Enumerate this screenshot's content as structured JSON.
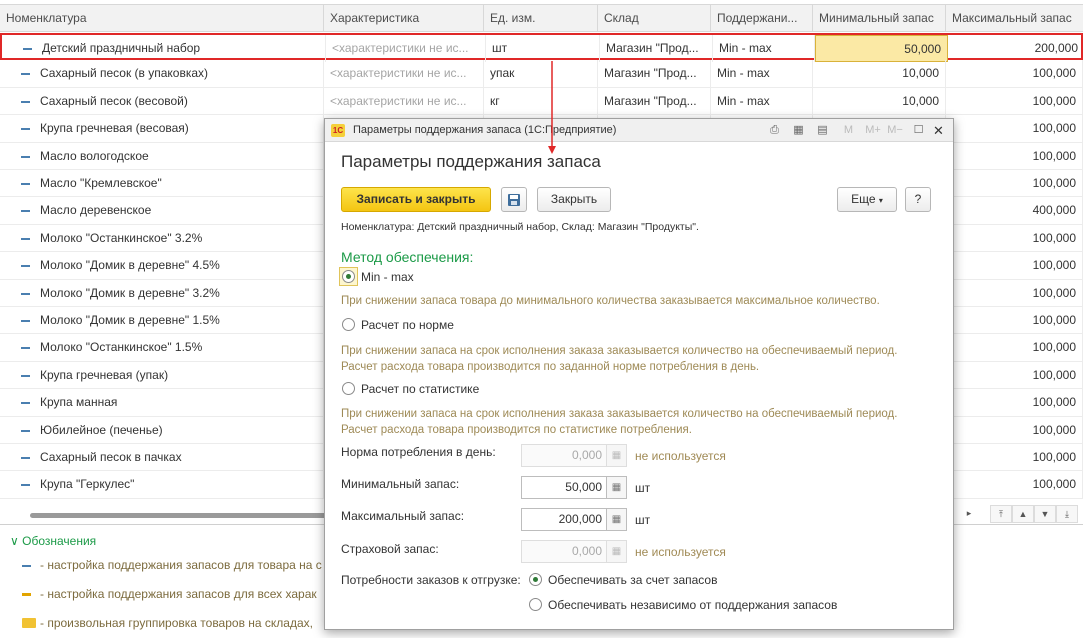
{
  "table": {
    "columns": [
      "Номенклатура",
      "Характеристика",
      "Ед. изм.",
      "Склад",
      "Поддержани...",
      "Минимальный запас",
      "Максимальный запас"
    ],
    "rows": [
      {
        "name": "Детский праздничный набор",
        "char": "<характеристики не ис...",
        "unit": "шт",
        "store": "Магазин \"Прод...",
        "method": "Min - max",
        "min": "50,000",
        "max": "200,000"
      },
      {
        "name": "Сахарный песок (в упаковках)",
        "char": "<характеристики не ис...",
        "unit": "упак",
        "store": "Магазин \"Прод...",
        "method": "Min - max",
        "min": "10,000",
        "max": "100,000"
      },
      {
        "name": "Сахарный песок (весовой)",
        "char": "<характеристики не ис...",
        "unit": "кг",
        "store": "Магазин \"Прод...",
        "method": "Min - max",
        "min": "10,000",
        "max": "100,000"
      },
      {
        "name": "Крупа гречневая (весовая)",
        "char": "",
        "unit": "",
        "store": "",
        "method": "",
        "min": "",
        "max": "100,000"
      },
      {
        "name": "Масло вологодское",
        "char": "",
        "unit": "",
        "store": "",
        "method": "",
        "min": "",
        "max": "100,000"
      },
      {
        "name": "Масло \"Кремлевское\"",
        "char": "",
        "unit": "",
        "store": "",
        "method": "",
        "min": "",
        "max": "100,000"
      },
      {
        "name": "Масло деревенское",
        "char": "",
        "unit": "",
        "store": "",
        "method": "",
        "min": "",
        "max": "400,000"
      },
      {
        "name": "Молоко \"Останкинское\" 3.2%",
        "char": "",
        "unit": "",
        "store": "",
        "method": "",
        "min": "",
        "max": "100,000"
      },
      {
        "name": "Молоко \"Домик в деревне\" 4.5%",
        "char": "",
        "unit": "",
        "store": "",
        "method": "",
        "min": "",
        "max": "100,000"
      },
      {
        "name": "Молоко \"Домик в деревне\" 3.2%",
        "char": "",
        "unit": "",
        "store": "",
        "method": "",
        "min": "",
        "max": "100,000"
      },
      {
        "name": "Молоко \"Домик в деревне\" 1.5%",
        "char": "",
        "unit": "",
        "store": "",
        "method": "",
        "min": "",
        "max": "100,000"
      },
      {
        "name": "Молоко \"Останкинское\" 1.5%",
        "char": "",
        "unit": "",
        "store": "",
        "method": "",
        "min": "",
        "max": "100,000"
      },
      {
        "name": "Крупа гречневая (упак)",
        "char": "",
        "unit": "",
        "store": "",
        "method": "",
        "min": "",
        "max": "100,000"
      },
      {
        "name": "Крупа манная",
        "char": "",
        "unit": "",
        "store": "",
        "method": "",
        "min": "",
        "max": "100,000"
      },
      {
        "name": "Юбилейное (печенье)",
        "char": "",
        "unit": "",
        "store": "",
        "method": "",
        "min": "",
        "max": "100,000"
      },
      {
        "name": "Сахарный песок в пачках",
        "char": "",
        "unit": "",
        "store": "",
        "method": "",
        "min": "",
        "max": "100,000"
      },
      {
        "name": "Крупа \"Геркулес\"",
        "char": "",
        "unit": "",
        "store": "",
        "method": "",
        "min": "",
        "max": "100,000"
      }
    ]
  },
  "legend": {
    "title": "Обозначения",
    "items": [
      "- настройка поддержания запасов для товара на с",
      "- настройка поддержания запасов для всех харак",
      "- произвольная группировка товаров на складах,"
    ]
  },
  "dialog": {
    "window_title": "Параметры поддержания запаса  (1С:Предприятие)",
    "logo": "1С",
    "title": "Параметры поддержания запаса",
    "btn_save_close": "Записать и закрыть",
    "btn_close": "Закрыть",
    "btn_more": "Еще",
    "btn_help": "?",
    "context": "Номенклатура: Детский праздничный набор, Склад: Магазин \"Продукты\".",
    "method_title": "Метод обеспечения:",
    "options": [
      {
        "label": "Min - max",
        "hint": "При снижении запаса товара до минимального количества заказывается максимальное количество.",
        "selected": true
      },
      {
        "label": "Расчет по норме",
        "hint": "При снижении запаса на срок исполнения заказа заказывается количество на обеспечиваемый период.\nРасчет расхода товара производится по заданной норме потребления в день.",
        "selected": false
      },
      {
        "label": "Расчет по статистике",
        "hint": "При снижении запаса на срок исполнения заказа заказывается количество на обеспечиваемый период.\nРасчет расхода товара производится по статистике потребления.",
        "selected": false
      }
    ],
    "fields": [
      {
        "label": "Норма потребления в день:",
        "value": "0,000",
        "unit": "не используется",
        "disabled": true
      },
      {
        "label": "Минимальный запас:",
        "value": "50,000",
        "unit": "шт",
        "disabled": false
      },
      {
        "label": "Максимальный запас:",
        "value": "200,000",
        "unit": "шт",
        "disabled": false
      },
      {
        "label": "Страховой запас:",
        "value": "0,000",
        "unit": "не используется",
        "disabled": true
      }
    ],
    "shipment_label": "Потребности заказов к отгрузке:",
    "shipment_options": [
      {
        "label": "Обеспечивать за счет запасов",
        "selected": true
      },
      {
        "label": "Обеспечивать независимо от поддержания запасов",
        "selected": false
      }
    ]
  },
  "colors": {
    "accent_green": "#1b9a47",
    "selection_red": "#e02828",
    "primary_yellow": "#f4c512"
  }
}
